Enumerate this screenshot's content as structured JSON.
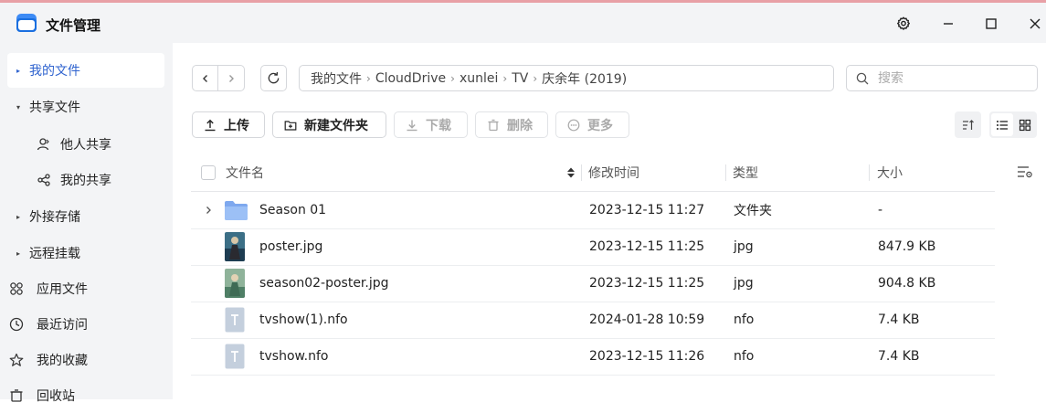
{
  "window": {
    "title": "文件管理",
    "controls": [
      "gear-icon",
      "minimize-icon",
      "maximize-icon",
      "close-icon"
    ]
  },
  "sidebar": {
    "items": [
      {
        "label": "我的文件",
        "active": true
      },
      {
        "label": "共享文件",
        "expanded": true
      },
      {
        "label": "他人共享",
        "icon": "person-icon"
      },
      {
        "label": "我的共享",
        "icon": "share-icon"
      },
      {
        "label": "外接存储"
      },
      {
        "label": "远程挂载"
      },
      {
        "label": "应用文件",
        "icon": "apps-icon"
      },
      {
        "label": "最近访问",
        "icon": "clock-icon"
      },
      {
        "label": "我的收藏",
        "icon": "star-icon"
      },
      {
        "label": "回收站",
        "icon": "trash-icon"
      }
    ]
  },
  "breadcrumb": [
    "我的文件",
    "CloudDrive",
    "xunlei",
    "TV",
    "庆余年 (2019)"
  ],
  "search": {
    "placeholder": "搜索",
    "value": ""
  },
  "toolbar": {
    "upload": "上传",
    "new_folder": "新建文件夹",
    "download": "下载",
    "delete": "删除",
    "more": "更多"
  },
  "table": {
    "columns": [
      "文件名",
      "修改时间",
      "类型",
      "大小"
    ],
    "rows": [
      {
        "name": "Season 01",
        "modified": "2023-12-15 11:27",
        "type": "文件夹",
        "size": "-",
        "icon": "folder-icon"
      },
      {
        "name": "poster.jpg",
        "modified": "2023-12-15 11:25",
        "type": "jpg",
        "size": "847.9 KB",
        "icon": "image-thumbnail"
      },
      {
        "name": "season02-poster.jpg",
        "modified": "2023-12-15 11:25",
        "type": "jpg",
        "size": "904.8 KB",
        "icon": "image-thumbnail"
      },
      {
        "name": "tvshow(1).nfo",
        "modified": "2024-01-28 10:59",
        "type": "nfo",
        "size": "7.4 KB",
        "icon": "text-file-icon"
      },
      {
        "name": "tvshow.nfo",
        "modified": "2023-12-15 11:26",
        "type": "nfo",
        "size": "7.4 KB",
        "icon": "text-file-icon"
      }
    ]
  },
  "colors": {
    "accent": "#2f63cf",
    "sidebar_bg": "#f3f4f6",
    "folder": "#8fb4f2"
  }
}
